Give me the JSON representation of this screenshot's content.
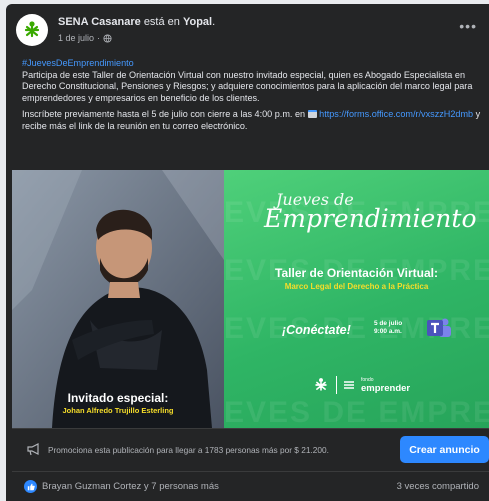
{
  "post": {
    "author": "SENA Casanare",
    "location_prefix": "está en",
    "location": "Yopal",
    "date": "1 de julio",
    "privacy_icon": "globe-icon",
    "more_icon": "more-icon",
    "hashtag": "#JuevesDeEmprendimiento",
    "paragraph1": "Participa de este Taller de Orientación Virtual con nuestro invitado especial, quien es Abogado Especialista en Derecho Constitucional, Pensiones y Riesgos; y adquiere conocimientos para la aplicación del marco legal para emprendedores y empresarios en beneficio de los clientes.",
    "paragraph2_prefix": "Inscríbete previamente hasta el 5 de julio con cierre a las 4:00 p.m. en",
    "link": "https://forms.office.com/r/vxszzH2dmb",
    "paragraph2_suffix": "y recibe más el link de la reunión en tu correo electrónico."
  },
  "banner": {
    "jueves": "Jueves de",
    "emprendimiento": "Emprendimiento",
    "watermark": "EVES DE EMPREN",
    "taller": "Taller de Orientación Virtual:",
    "marco": "Marco Legal del Derecho a la Práctica",
    "conectate": "¡Conéctate!",
    "date_line1": "5 de julio",
    "date_line2": "9:00 a.m.",
    "fondo": "fondo",
    "emprender": "emprender",
    "invitado": "Invitado especial:",
    "johan": "Johan Alfredo Trujillo Esterling"
  },
  "promo": {
    "text": "Promociona esta publicación para llegar a 1783 personas más por $ 21.200.",
    "button": "Crear anuncio"
  },
  "footer": {
    "reactors": "Brayan Guzman Cortez y 7 personas más",
    "shares": "3 veces compartido"
  },
  "colors": {
    "background": "#242526",
    "link": "#4599ff",
    "accent_button": "#2d88ff",
    "banner_green": "#2fb565",
    "highlight_yellow": "#f6dd2a"
  }
}
